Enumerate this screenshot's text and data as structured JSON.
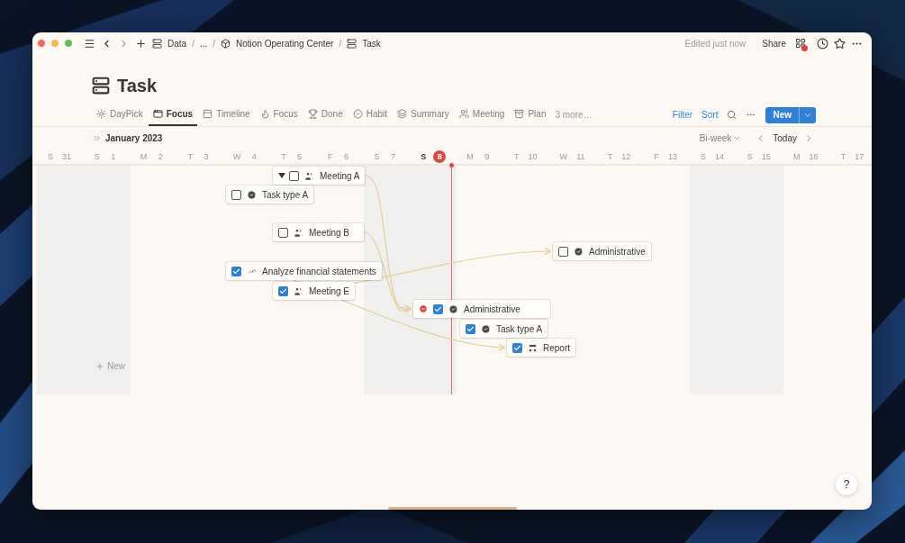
{
  "window": {
    "breadcrumb": [
      {
        "label": "Data",
        "kind": "database"
      },
      {
        "label": "...",
        "kind": "ellipsis",
        "separator": "/"
      },
      {
        "label": "Notion Operating Center",
        "kind": "cube",
        "separator": "/"
      },
      {
        "label": "Task",
        "kind": "database",
        "separator": "/"
      }
    ],
    "edited": "Edited just now",
    "share": "Share"
  },
  "page": {
    "title": "Task"
  },
  "views": [
    {
      "label": "DayPick",
      "kind": "daypick",
      "selected": false
    },
    {
      "label": "Focus",
      "kind": "board",
      "selected": true
    },
    {
      "label": "Timeline",
      "kind": "timeline",
      "selected": false
    },
    {
      "label": "Focus",
      "kind": "flame",
      "selected": false
    },
    {
      "label": "Done",
      "kind": "trophy",
      "selected": false
    },
    {
      "label": "Habit",
      "kind": "badge",
      "selected": false
    },
    {
      "label": "Summary",
      "kind": "layers",
      "selected": false
    },
    {
      "label": "Meeting",
      "kind": "people",
      "selected": false
    },
    {
      "label": "Plan",
      "kind": "archive",
      "selected": false
    }
  ],
  "more_views": "3 more…",
  "toolbar": {
    "filter": "Filter",
    "sort": "Sort",
    "new": "New"
  },
  "timeline": {
    "month": "January 2023",
    "range": "Bi-week",
    "today": "Today",
    "days": [
      {
        "weekday": "S",
        "date": "31",
        "weekend": true,
        "today": false
      },
      {
        "weekday": "S",
        "date": "1",
        "weekend": true,
        "today": false
      },
      {
        "weekday": "M",
        "date": "2",
        "weekend": false,
        "today": false
      },
      {
        "weekday": "T",
        "date": "3",
        "weekend": false,
        "today": false
      },
      {
        "weekday": "W",
        "date": "4",
        "weekend": false,
        "today": false
      },
      {
        "weekday": "T",
        "date": "5",
        "weekend": false,
        "today": false
      },
      {
        "weekday": "F",
        "date": "6",
        "weekend": false,
        "today": false
      },
      {
        "weekday": "S",
        "date": "7",
        "weekend": true,
        "today": false
      },
      {
        "weekday": "S",
        "date": "8",
        "weekend": true,
        "today": true
      },
      {
        "weekday": "M",
        "date": "9",
        "weekend": false,
        "today": false
      },
      {
        "weekday": "T",
        "date": "10",
        "weekend": false,
        "today": false
      },
      {
        "weekday": "W",
        "date": "11",
        "weekend": false,
        "today": false
      },
      {
        "weekday": "T",
        "date": "12",
        "weekend": false,
        "today": false
      },
      {
        "weekday": "F",
        "date": "13",
        "weekend": false,
        "today": false
      },
      {
        "weekday": "S",
        "date": "14",
        "weekend": true,
        "today": false
      },
      {
        "weekday": "S",
        "date": "15",
        "weekend": true,
        "today": false
      },
      {
        "weekday": "M",
        "date": "16",
        "weekend": false,
        "today": false
      },
      {
        "weekday": "T",
        "date": "17",
        "weekend": false,
        "today": false
      }
    ],
    "tasks": [
      {
        "label": "Meeting A",
        "kind": "meeting",
        "checked": false,
        "expanded": true,
        "blocked": false
      },
      {
        "label": "Task type A",
        "kind": "task",
        "checked": false,
        "blocked": false
      },
      {
        "label": "Meeting B",
        "kind": "meeting",
        "checked": false,
        "blocked": false
      },
      {
        "label": "Administrative",
        "kind": "task",
        "checked": false,
        "blocked": false
      },
      {
        "label": "Analyze financial statements",
        "kind": "analysis",
        "checked": true,
        "blocked": false
      },
      {
        "label": "Meeting E",
        "kind": "meeting",
        "checked": true,
        "blocked": false
      },
      {
        "label": "Administrative",
        "kind": "task",
        "checked": true,
        "blocked": true
      },
      {
        "label": "Task type A",
        "kind": "task",
        "checked": true,
        "blocked": false
      },
      {
        "label": "Report",
        "kind": "report",
        "checked": true,
        "blocked": false
      }
    ],
    "new_item": "New"
  },
  "help": "?"
}
